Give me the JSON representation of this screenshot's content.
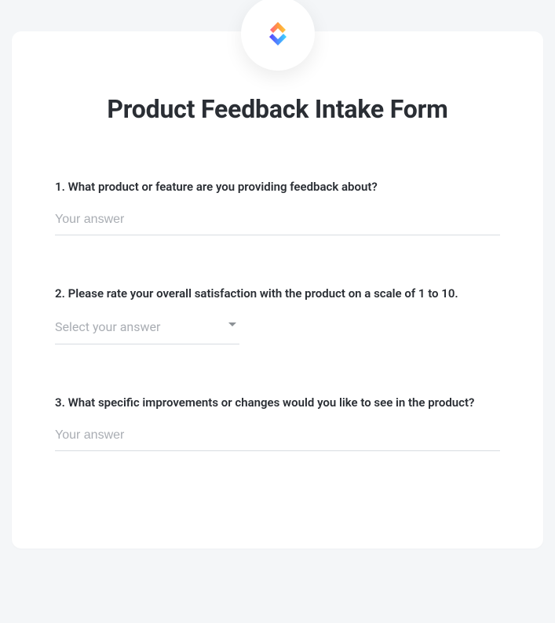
{
  "form": {
    "title": "Product Feedback Intake Form",
    "logo": "clickup-logo",
    "questions": [
      {
        "number": "1.",
        "label": "What product or feature are you providing feedback about?",
        "type": "text",
        "placeholder": "Your answer"
      },
      {
        "number": "2.",
        "label": "Please rate your overall satisfaction with the product on a scale of 1 to 10.",
        "type": "select",
        "placeholder": "Select your answer"
      },
      {
        "number": "3.",
        "label": "What specific improvements or changes would you like to see in the product?",
        "type": "text",
        "placeholder": "Your answer"
      }
    ]
  }
}
